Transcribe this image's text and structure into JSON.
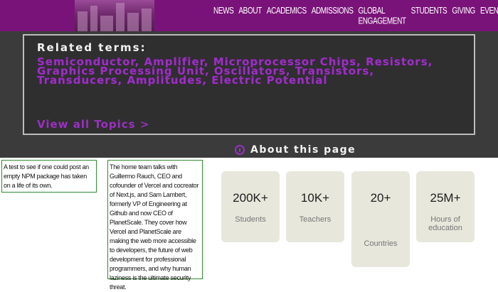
{
  "nav": [
    "NEWS",
    "ABOUT",
    "ACADEMICS",
    "ADMISSIONS",
    "GLOBAL ENGAGEMENT",
    "STUDENTS",
    "GIVING",
    "EVENTS"
  ],
  "related": {
    "title": "Related terms:",
    "terms_text": "Semiconductor, Amplifier, Microprocessor Chips, Resistors, Graphics Processing Unit, Oscillators, Transistors, Transducers, Amplitudes, Electric Potential",
    "view_all": "View all Topics  >"
  },
  "about": {
    "label": "About this page",
    "icon": "info-icon"
  },
  "cards": [
    "A test to see if one could post an empty NPM package has taken on a life of its own.",
    "The home team talks with Guillermo Rauch, CEO and cofounder of Vercel and cocreator of Next.js, and Sam Lambert, formerly VP of Engineering at Github and now CEO of PlanetScale. They cover how Vercel and PlanetScale are making the web more accessible to developers, the future of web development for professional programmers, and why human laziness is the ultimate security threat."
  ],
  "stats": [
    {
      "value": "200K+",
      "label": "Students"
    },
    {
      "value": "10K+",
      "label": "Teachers"
    },
    {
      "value": "20+",
      "label": "Countries"
    },
    {
      "value": "25M+",
      "label": "Hours of education"
    }
  ],
  "colors": {
    "header_bg": "#7a1379",
    "accent_purple": "#9c2fc4",
    "dark_panel": "#3b3b3b",
    "card_border": "#2f8a2f",
    "stat_bg": "#e7e7dc"
  }
}
